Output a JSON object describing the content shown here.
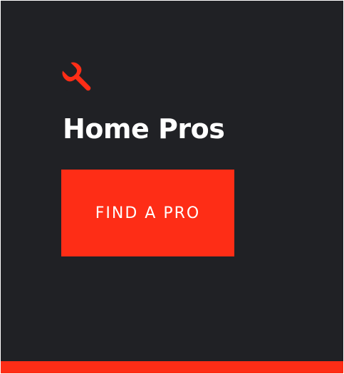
{
  "card": {
    "icon": "wrench-icon",
    "title": "Home Pros",
    "cta_label": "FIND A PRO"
  },
  "colors": {
    "background": "#202125",
    "accent": "#fe2d16",
    "text": "#ffffff"
  }
}
